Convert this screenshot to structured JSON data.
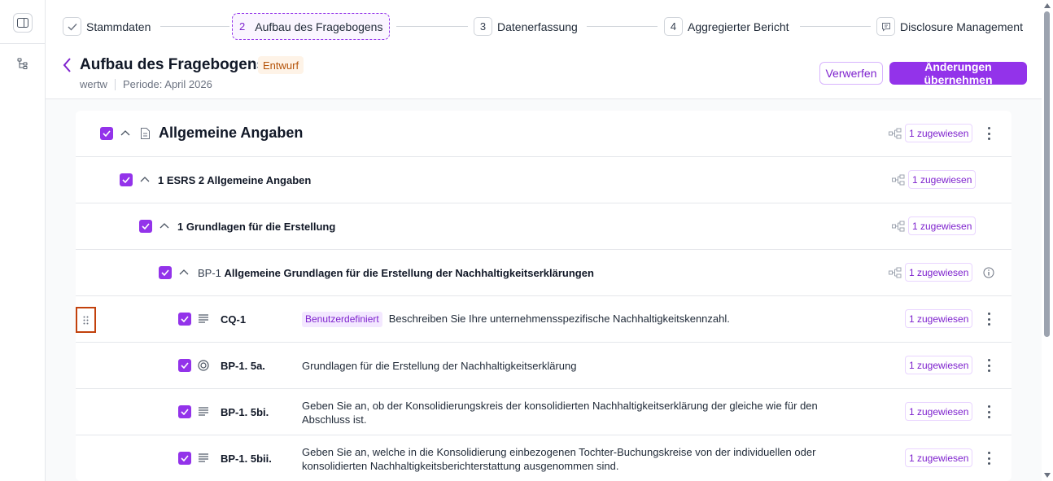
{
  "stepper": {
    "steps": [
      {
        "num": "",
        "label": "Stammdaten",
        "state": "done"
      },
      {
        "num": "2",
        "label": "Aufbau des Fragebogens",
        "state": "active"
      },
      {
        "num": "3",
        "label": "Datenerfassung",
        "state": "todo"
      },
      {
        "num": "4",
        "label": "Aggregierter Bericht",
        "state": "todo"
      },
      {
        "num": "",
        "label": "Disclosure Management",
        "state": "todo"
      }
    ]
  },
  "header": {
    "title": "Aufbau des Fragebogens",
    "status_badge": "Entwurf",
    "entity": "wertw",
    "period": "Periode: April 2026",
    "discard_label": "Verwerfen",
    "apply_label": "Änderungen übernehmen"
  },
  "tree": [
    {
      "level": 0,
      "label": "Allgemeine Angaben",
      "assigned": "1 zugewiesen"
    },
    {
      "level": 1,
      "label": "1 ESRS 2 Allgemeine Angaben",
      "assigned": "1 zugewiesen"
    },
    {
      "level": 2,
      "label": "1 Grundlagen für die Erstellung",
      "assigned": "1 zugewiesen"
    },
    {
      "level": 3,
      "code": "BP-1",
      "label": "Allgemeine Grundlagen für die Erstellung der Nachhaltigkeitserklärungen",
      "assigned": "1 zugewiesen"
    }
  ],
  "questions": [
    {
      "id": "CQ-1",
      "icon": "text-lines-icon",
      "badge": "Benutzerdefiniert",
      "text": "Beschreiben Sie Ihre unternehmensspezifische Nachhaltigkeitskennzahl.",
      "assigned": "1 zugewiesen"
    },
    {
      "id": "BP-1. 5a.",
      "icon": "radio-target-icon",
      "badge": "",
      "text": "Grundlagen für die Erstellung der Nachhaltigkeitserklärung",
      "assigned": "1 zugewiesen"
    },
    {
      "id": "BP-1. 5bi.",
      "icon": "text-lines-icon",
      "badge": "",
      "text": "Geben Sie an, ob der Konsolidierungskreis der konsolidierten Nachhaltigkeitserklärung der gleiche wie für den Abschluss ist.",
      "assigned": "1 zugewiesen"
    },
    {
      "id": "BP-1. 5bii.",
      "icon": "text-lines-icon",
      "badge": "",
      "text": "Geben Sie an, welche in die Konsolidierung einbezogenen Tochter-Buchungskreise von der individuellen oder konsolidierten Nachhaltigkeitsberichterstattung ausgenommen sind.",
      "assigned": "1 zugewiesen"
    }
  ],
  "colors": {
    "accent": "#9333ea",
    "draft_bg": "#fef3e7",
    "draft_text": "#b45309",
    "drag_highlight": "#c2410c"
  }
}
